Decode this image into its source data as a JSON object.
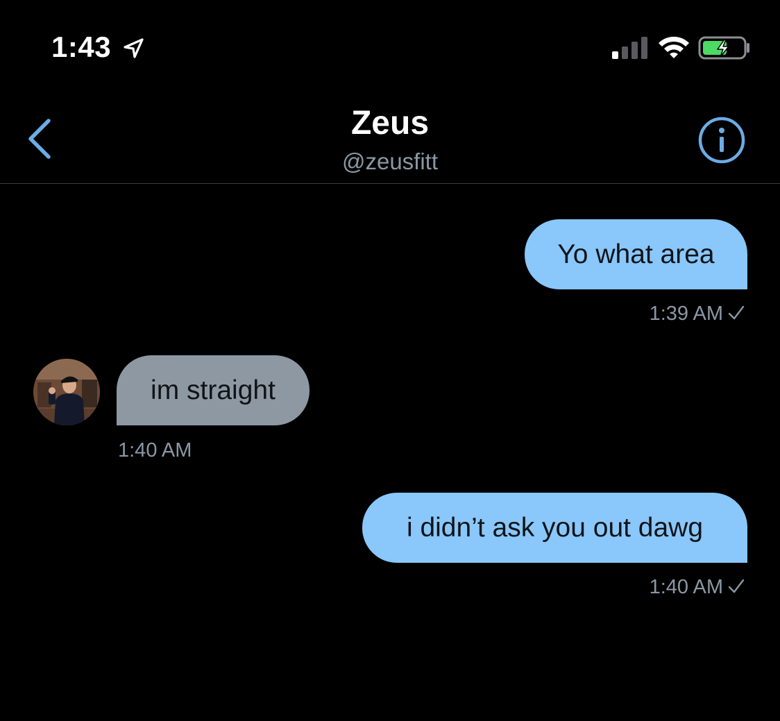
{
  "status_bar": {
    "time": "1:43",
    "location_icon": "location-arrow-icon",
    "signal_icon": "cellular-signal-icon",
    "wifi_icon": "wifi-icon",
    "battery_icon": "battery-charging-icon"
  },
  "header": {
    "back_icon": "chevron-left-icon",
    "name": "Zeus",
    "handle": "@zeusfitt",
    "info_icon": "info-circle-icon"
  },
  "messages": [
    {
      "direction": "sent",
      "text": "Yo what area",
      "time": "1:39 AM",
      "read_icon": "check-icon"
    },
    {
      "direction": "received",
      "text": "im straight",
      "time": "1:40 AM"
    },
    {
      "direction": "sent",
      "text": "i didn’t ask you out dawg",
      "time": "1:40 AM",
      "read_icon": "check-icon"
    }
  ],
  "colors": {
    "background": "#000000",
    "accent": "#8ac7fb",
    "sent_bubble": "#8ac7fb",
    "received_bubble": "#8e98a2",
    "secondary_text": "#8b98a5",
    "battery_fill": "#4cd964"
  }
}
